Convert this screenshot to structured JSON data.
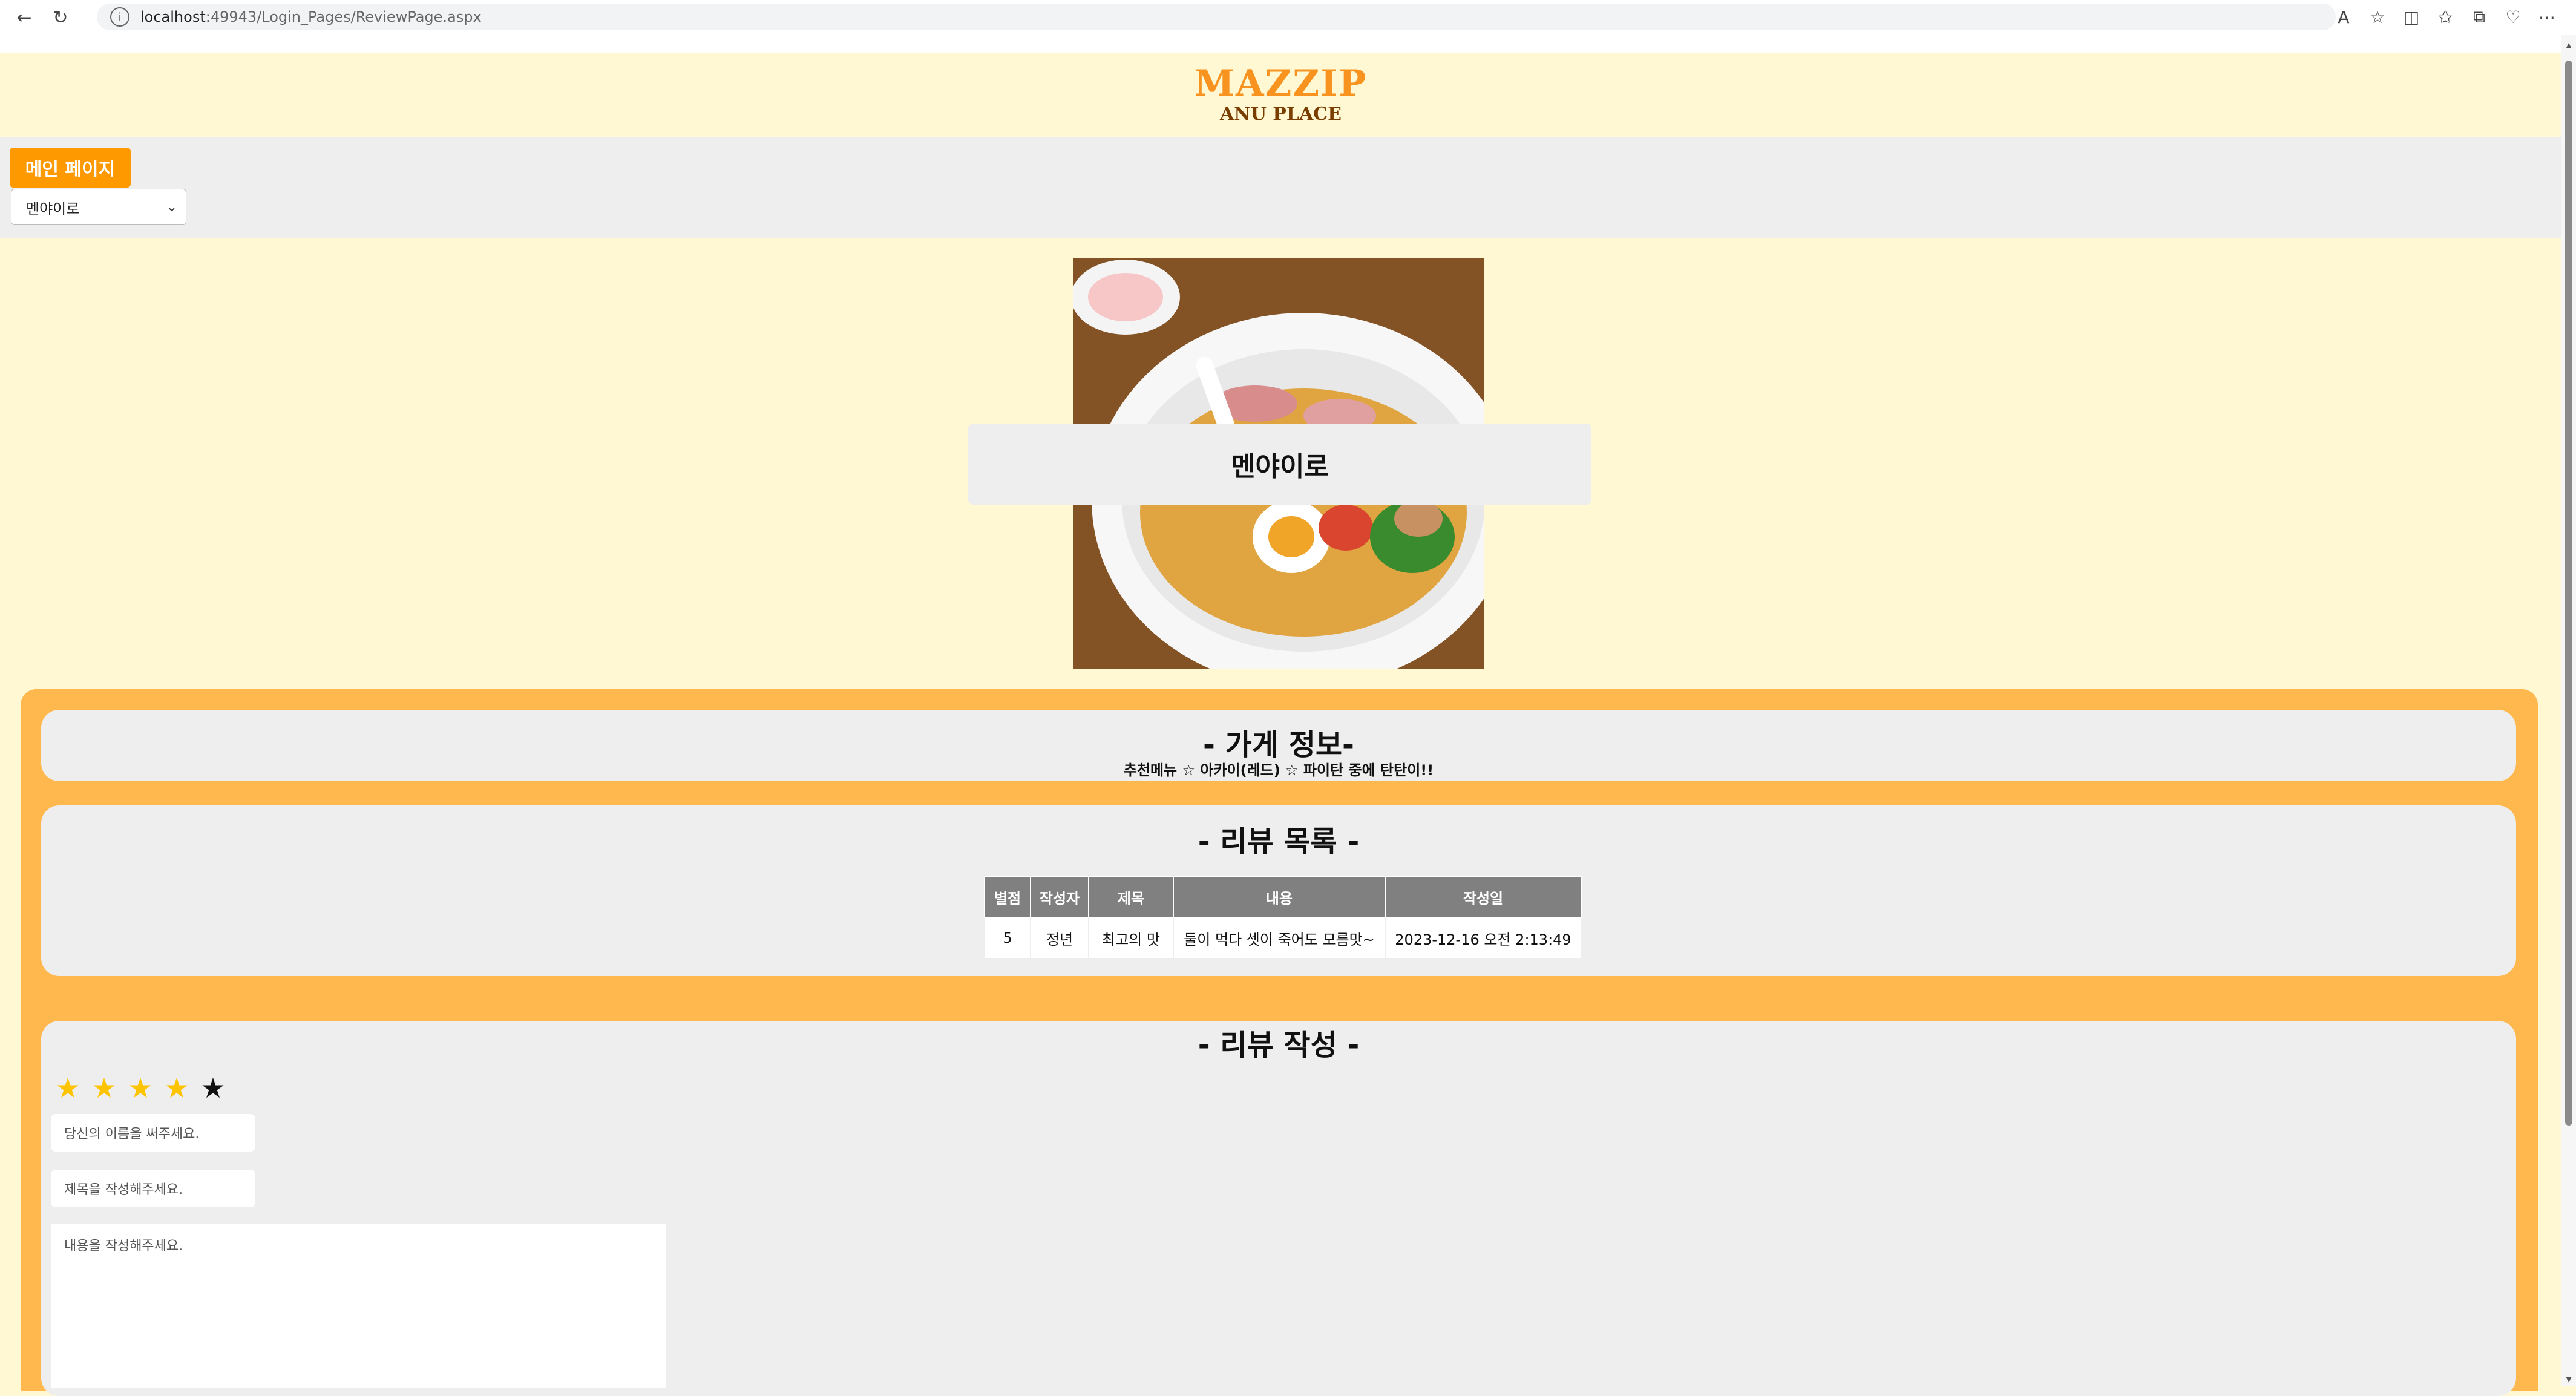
{
  "browser": {
    "url_host": "localhost",
    "url_path": ":49943/Login_Pages/ReviewPage.aspx"
  },
  "header": {
    "logo_title": "MAZZIP",
    "logo_subtitle": "ANU PLACE"
  },
  "nav": {
    "main_page_button": "메인 페이지",
    "store_select_value": "멘야이로"
  },
  "hero": {
    "store_name": "멘야이로"
  },
  "store_info": {
    "title": "- 가게 정보-",
    "description": "추천메뉴 ☆ 아카이(레드) ☆ 파이탄 중에 탄탄이!!"
  },
  "review_list": {
    "title": "- 리뷰 목록 -",
    "columns": [
      "별점",
      "작성자",
      "제목",
      "내용",
      "작성일"
    ],
    "rows": [
      {
        "rating": "5",
        "author": "정년",
        "subject": "최고의 맛",
        "content": "둘이 먹다 셋이 죽어도 모름맛~",
        "date": "2023-12-16 오전 2:13:49"
      }
    ]
  },
  "review_write": {
    "title": "- 리뷰 작성 -",
    "rating_selected": 4,
    "rating_max": 5,
    "name_placeholder": "당신의 이름을 써주세요.",
    "title_placeholder": "제목을 작성해주세요.",
    "content_placeholder": "내용을 작성해주세요."
  },
  "colors": {
    "page_bg": "#fff8d2",
    "accent_orange": "#ff9900",
    "frame_orange": "#ffb84d",
    "logo_orange": "#f7931e",
    "panel_gray": "#eeeeee",
    "table_header": "#808080",
    "star_on": "#ffc400"
  }
}
